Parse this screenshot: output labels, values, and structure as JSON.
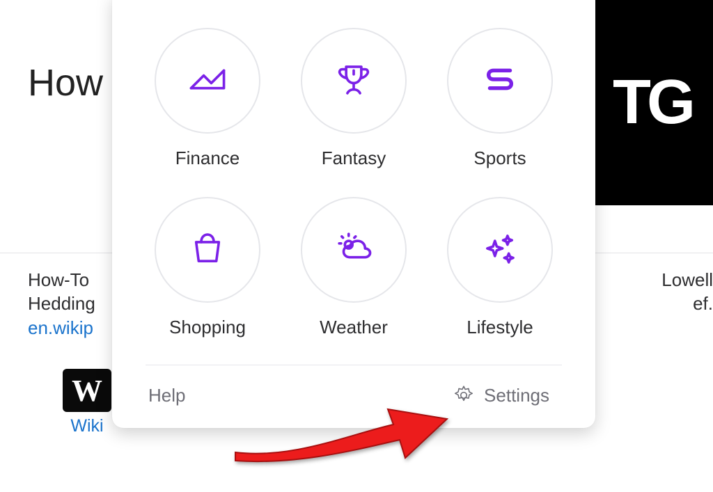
{
  "background": {
    "title_fragment": "How",
    "tile_text": "TG",
    "snippet_line1": "How-To",
    "snippet_line2": "Hedding",
    "snippet_link_text": "en.wikip",
    "right_line1": " Lowell",
    "right_line2": "ef.",
    "wiki_letter": "W",
    "wiki_label": "Wiki"
  },
  "panel": {
    "items": [
      {
        "id": "finance",
        "label": "Finance",
        "icon": "line-chart-icon"
      },
      {
        "id": "fantasy",
        "label": "Fantasy",
        "icon": "trophy-icon"
      },
      {
        "id": "sports",
        "label": "Sports",
        "icon": "s-mark-icon"
      },
      {
        "id": "shopping",
        "label": "Shopping",
        "icon": "shopping-bag-icon"
      },
      {
        "id": "weather",
        "label": "Weather",
        "icon": "weather-icon"
      },
      {
        "id": "lifestyle",
        "label": "Lifestyle",
        "icon": "sparkles-icon"
      }
    ],
    "help_label": "Help",
    "settings_label": "Settings"
  },
  "annotation": {
    "arrow_target": "settings"
  },
  "colors": {
    "accent_purple": "#7b21e8",
    "annotation_red": "#ec1c1c"
  }
}
